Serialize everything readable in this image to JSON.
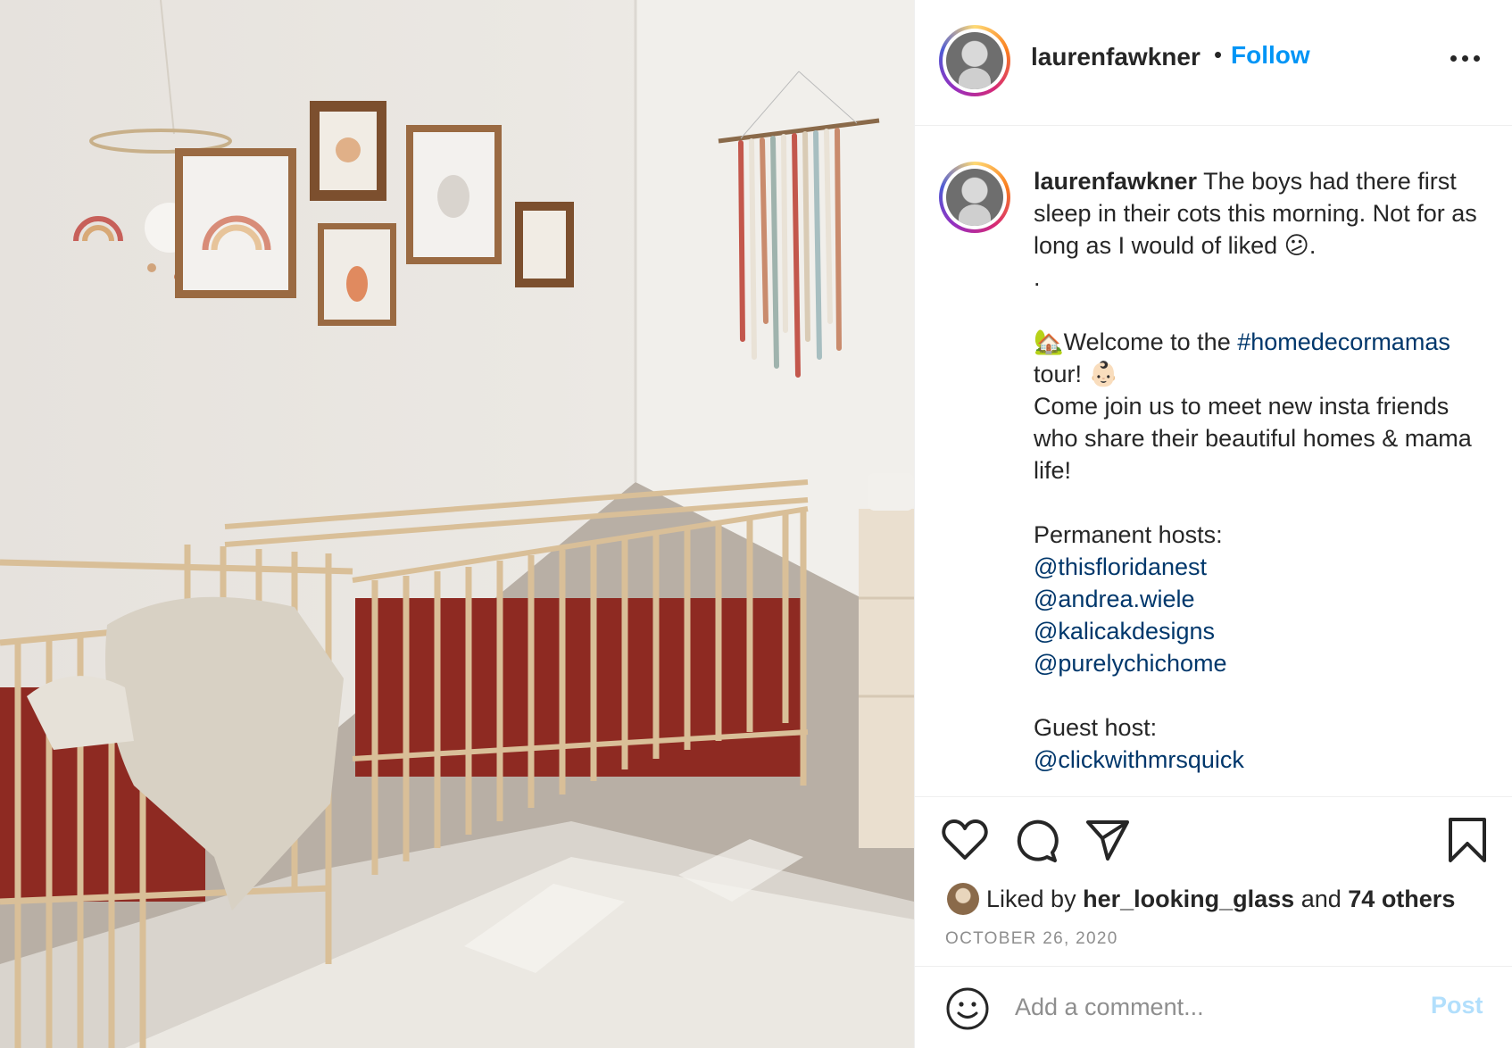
{
  "post": {
    "username": "laurenfawkner",
    "follow_label": "Follow",
    "separator": "•"
  },
  "caption": {
    "username": "laurenfawkner",
    "line1": "The boys had there first sleep in their cots this morning. Not for as long as I would of liked 😕.",
    "line2": ".",
    "welcome_prefix": "🏡Welcome to the ",
    "hashtag": "#homedecormamas",
    "welcome_suffix": " tour! 👶🏻",
    "join_text": "Come join us to meet new insta friends who share their beautiful homes & mama life!",
    "permanent_label": "Permanent hosts:",
    "permanent_hosts": [
      "@thisfloridanest",
      "@andrea.wiele",
      "@kalicakdesigns",
      "@purelychichome"
    ],
    "guest_label": "Guest host:",
    "guest_host": "@clickwithmrsquick"
  },
  "likes": {
    "prefix": "Liked by ",
    "liker": "her_looking_glass",
    "middle": " and ",
    "others": "74 others"
  },
  "date": "OCTOBER 26, 2020",
  "comment": {
    "placeholder": "Add a comment...",
    "post_label": "Post"
  },
  "icons": {
    "like": "heart-icon",
    "comment": "speech-bubble-icon",
    "share": "paper-plane-icon",
    "save": "bookmark-icon",
    "emoji": "smiley-icon",
    "more": "ellipsis-icon"
  },
  "colors": {
    "link": "#00376b",
    "follow": "#0095f6",
    "post_disabled": "#b2dffc",
    "secondary_text": "#8e8e8e"
  }
}
